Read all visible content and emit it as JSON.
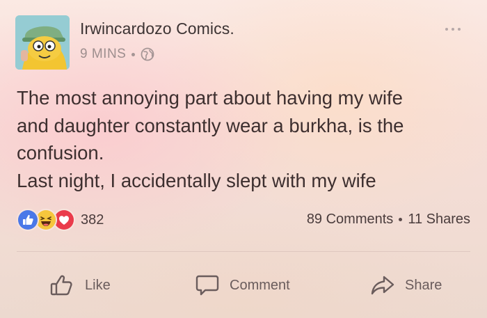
{
  "post": {
    "page_name": "Irwincardozo Comics.",
    "time": "9 MINS",
    "privacy_icon": "globe-icon",
    "text": "The most annoying part about having my wife\nand daughter constantly wear a burkha, is the\nconfusion.\nLast night, I accidentally slept with my wife"
  },
  "reactions": {
    "icons": [
      "like-reaction-icon",
      "haha-reaction-icon",
      "love-reaction-icon"
    ],
    "count": "382",
    "comments": "89 Comments",
    "shares": "11 Shares"
  },
  "actions": {
    "like_label": "Like",
    "comment_label": "Comment",
    "share_label": "Share"
  },
  "colors": {
    "like_blue": "#4a78e8",
    "haha_yellow": "#f6c63d",
    "love_red": "#ea3b4b"
  }
}
